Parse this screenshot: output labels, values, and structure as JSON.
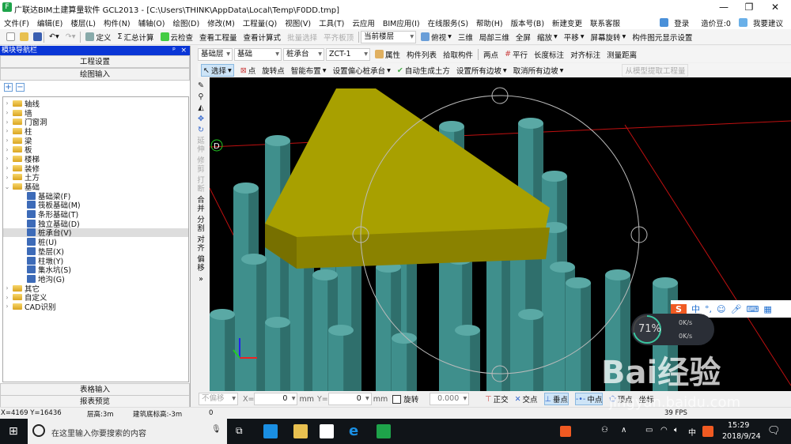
{
  "window": {
    "title": "广联达BIM土建算量软件 GCL2013 - [C:\\Users\\THINK\\AppData\\Local\\Temp\\F0DD.tmp]",
    "logo": "F",
    "minimize": "—",
    "maximize": "❐",
    "close": "✕"
  },
  "menu": [
    "文件(F)",
    "编辑(E)",
    "楼层(L)",
    "构件(N)",
    "辅轴(O)",
    "绘图(D)",
    "修改(M)",
    "工程量(Q)",
    "视图(V)",
    "工具(T)",
    "云应用",
    "BIM应用(I)",
    "在线服务(S)",
    "帮助(H)",
    "版本号(B)",
    "新建变更",
    "联系客服"
  ],
  "account": {
    "login": "登录",
    "price_beans": "造价豆:0",
    "suggest": "我要建议"
  },
  "toolbar1": {
    "define": "定义",
    "sum": "汇总计算",
    "cloud_check": "云检查",
    "view_qty": "查看工程量",
    "view_formula": "查看计算式",
    "batch_select": "批量选择",
    "align_top": "平齐板顶",
    "floor_combo": "当前楼层",
    "top_view": "俯视",
    "three_d": "三维",
    "partial_3d": "局部三维",
    "fullscreen": "全屏",
    "zoom": "缩放",
    "pan": "平移",
    "rotate_screen": "屏幕旋转",
    "display_settings": "构件图元显示设置"
  },
  "nav": {
    "title": "模块导航栏",
    "project_settings": "工程设置",
    "drawing_input": "绘图输入",
    "table_input": "表格输入",
    "report_preview": "报表预览",
    "tree": [
      "轴线",
      "墙",
      "门窗洞",
      "柱",
      "梁",
      "板",
      "楼梯",
      "装修",
      "土方"
    ],
    "foundation": "基础",
    "foundation_items": [
      "基础梁(F)",
      "筏板基础(M)",
      "条形基础(T)",
      "独立基础(D)",
      "桩承台(V)",
      "桩(U)",
      "垫层(X)",
      "柱墩(Y)",
      "集水坑(S)",
      "地沟(G)"
    ],
    "tree_after": [
      "其它",
      "自定义",
      "CAD识别"
    ]
  },
  "toolbar2": {
    "layer": "基础层",
    "type": "基础",
    "component": "桩承台",
    "name": "ZCT-1",
    "properties": "属性",
    "component_list": "构件列表",
    "pick": "拾取构件",
    "two_points": "两点",
    "parallel": "平行",
    "length_dim": "长度标注",
    "align_dim": "对齐标注",
    "measure": "测量距离"
  },
  "toolbar3": {
    "select": "选择",
    "point": "点",
    "rotate_point": "旋转点",
    "smart_layout": "智能布置",
    "eccentric": "设置偏心桩承台",
    "auto_earth": "自动生成土方",
    "set_slopes": "设置所有边坡",
    "cancel_slopes": "取消所有边坡",
    "extract": "从模型提取工程量"
  },
  "vtoolbar": [
    "延伸",
    "修剪",
    "打断",
    "合并",
    "分割",
    "对齐",
    "偏移"
  ],
  "viewport": {
    "axis_label": "D"
  },
  "bottom": {
    "offset": "不偏移",
    "x_label": "X=",
    "x_value": "0",
    "y_label": "Y=",
    "y_value": "0",
    "unit": "mm",
    "rotate": "旋转",
    "angle": "0.000",
    "snaps": [
      "正交",
      "交点",
      "垂点",
      "中点",
      "顶点",
      "坐标"
    ]
  },
  "status": {
    "coords": "X=4169 Y=16436",
    "floor_height": "层高:3m",
    "base_elev": "建筑底标高:-3m",
    "value": "0",
    "fps": "39 FPS"
  },
  "ime": {
    "mode": "中",
    "punct": "°,"
  },
  "gauge": {
    "percent": 71,
    "up": "0K/s",
    "down": "0K/s"
  },
  "watermark": {
    "brand": "Bai经验",
    "url": "jingyan.baidu.com"
  },
  "taskbar": {
    "search_placeholder": "在这里输入你要搜索的内容",
    "time": "15:29",
    "date": "2018/9/24",
    "ime": "中"
  },
  "colors": {
    "nav_header": "#0a36d6",
    "pile": "#3f8f8c",
    "cap": "#a8a000",
    "viewport_bg": "#000000"
  }
}
